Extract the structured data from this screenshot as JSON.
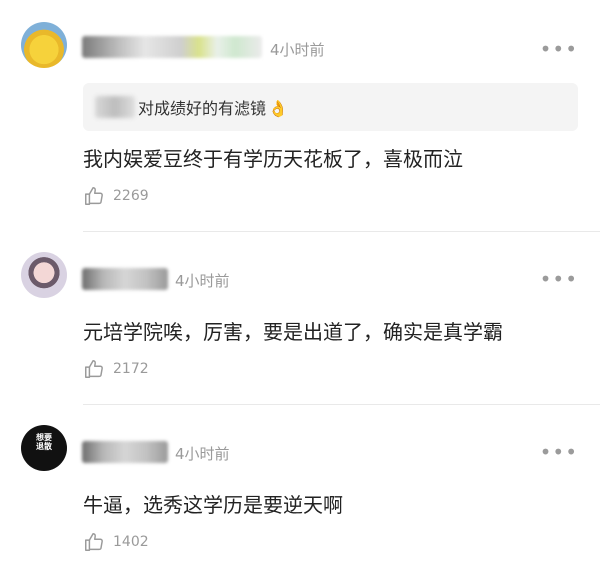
{
  "comments": [
    {
      "time": "4小时前",
      "quote": "对成绩好的有滤镜",
      "text": "我内娱爱豆终于有学历天花板了，喜极而泣",
      "likes": "2269"
    },
    {
      "time": "4小时前",
      "text": "元培学院唉，厉害，要是出道了，确实是真学霸",
      "likes": "2172"
    },
    {
      "time": "4小时前",
      "text": "牛逼，选秀这学历是要逆天啊",
      "likes": "1402",
      "avatar_text": "想要退散"
    }
  ],
  "icons": {
    "more": "more-icon",
    "like": "thumb-up-icon",
    "emoji": "ok-hand-emoji"
  },
  "colors": {
    "secondary_text": "#9a9a9a",
    "quote_bg": "#f4f4f4",
    "divider": "#e9e9e9"
  }
}
